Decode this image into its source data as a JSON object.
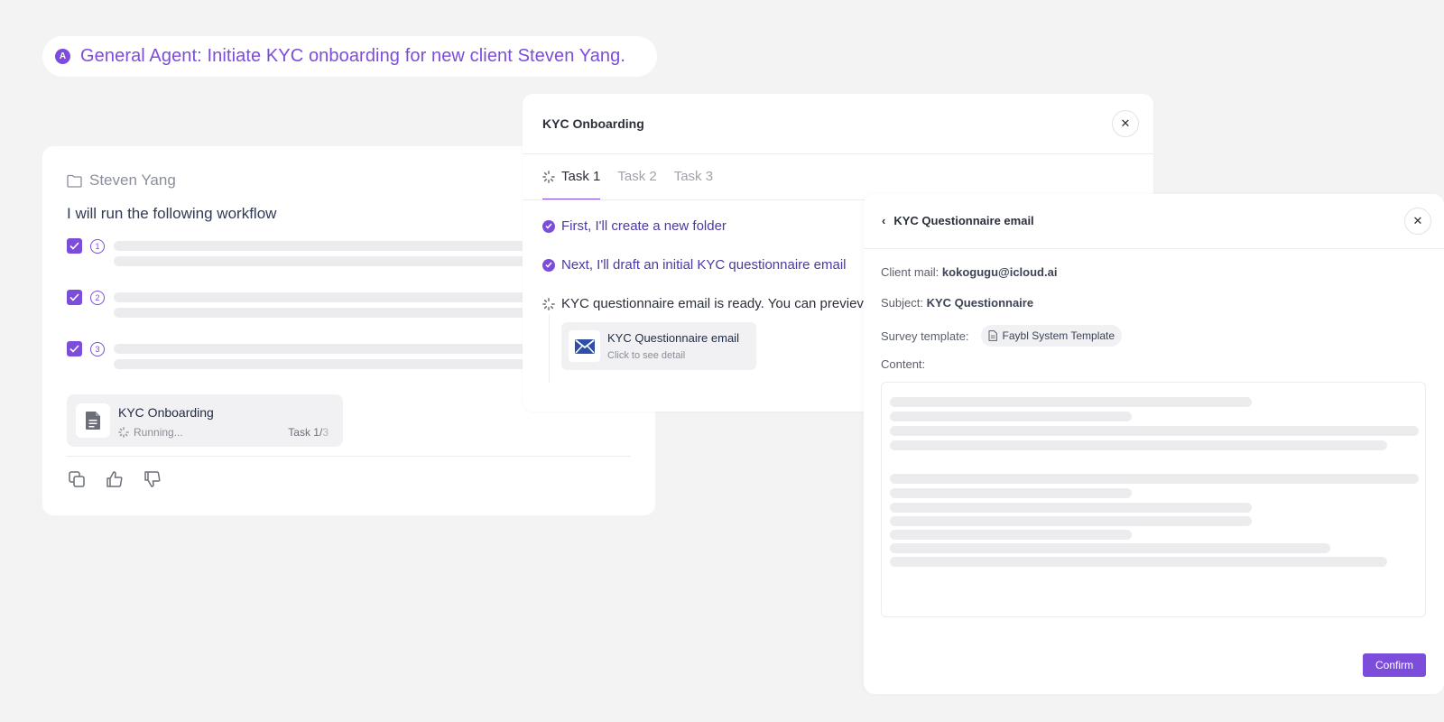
{
  "prompt": {
    "badge": "A",
    "text": "General Agent: Initiate KYC onboarding for new client Steven Yang."
  },
  "chat": {
    "folder_name": "Steven Yang",
    "intro": "I will run the following workflow",
    "steps": [
      {
        "number": "1",
        "checked": true
      },
      {
        "number": "2",
        "checked": true
      },
      {
        "number": "3",
        "checked": true
      }
    ],
    "task_chip": {
      "title": "KYC Onboarding",
      "status": "Running...",
      "task_label": "Task 1/",
      "task_total": "3"
    },
    "actions": [
      "copy-icon",
      "thumbs-up-icon",
      "thumbs-down-icon"
    ]
  },
  "onboarding": {
    "title": "KYC Onboarding",
    "close": "✕",
    "tabs": [
      "Task 1",
      "Task 2",
      "Task 3"
    ],
    "active_tab": "Task 1",
    "log": [
      {
        "text": "First, I'll create a new folder",
        "state": "done"
      },
      {
        "text": "Next, I'll draft an initial KYC questionnaire email",
        "state": "done"
      },
      {
        "text": "KYC questionnaire email is ready. You can previev",
        "state": "pending"
      }
    ],
    "email_chip": {
      "title": "KYC Questionnaire email",
      "subtitle": "Click to see detail"
    }
  },
  "detail": {
    "back_icon": "‹",
    "title": "KYC Questionnaire email",
    "close": "✕",
    "client_mail_label": "Client mail:",
    "client_mail_value": "kokogugu@icloud.ai",
    "subject_label": "Subject:",
    "subject_value": "KYC Questionnaire",
    "template_label": "Survey template:",
    "template_value": "Faybl System Template",
    "content_label": "Content:",
    "confirm_label": "Confirm"
  },
  "colors": {
    "accent": "#7c4ddb",
    "background": "#f3f3f4",
    "placeholder": "#ececee"
  }
}
